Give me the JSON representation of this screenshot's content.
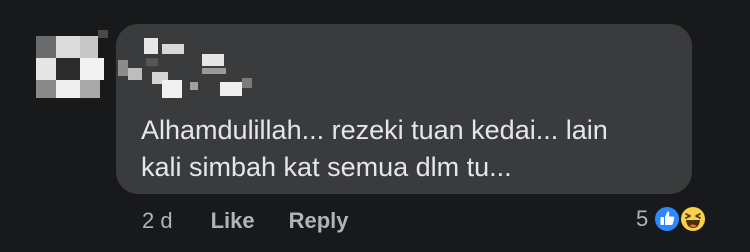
{
  "comment": {
    "lines": [
      "Alhamdulillah... rezeki tuan kedai... lain",
      "kali simbah kat semua dlm tu..."
    ]
  },
  "actions": {
    "timestamp": "2 d",
    "like_label": "Like",
    "reply_label": "Reply"
  },
  "reactions": {
    "count": "5",
    "icons": [
      "like-reaction-icon",
      "haha-reaction-icon"
    ]
  },
  "colors": {
    "background": "#18191a",
    "bubble": "#3a3b3c",
    "text": "#e4e6eb",
    "secondary_text": "#b0b3b8",
    "like_blue": "#2d88ff",
    "haha_yellow": "#f7d14e"
  }
}
